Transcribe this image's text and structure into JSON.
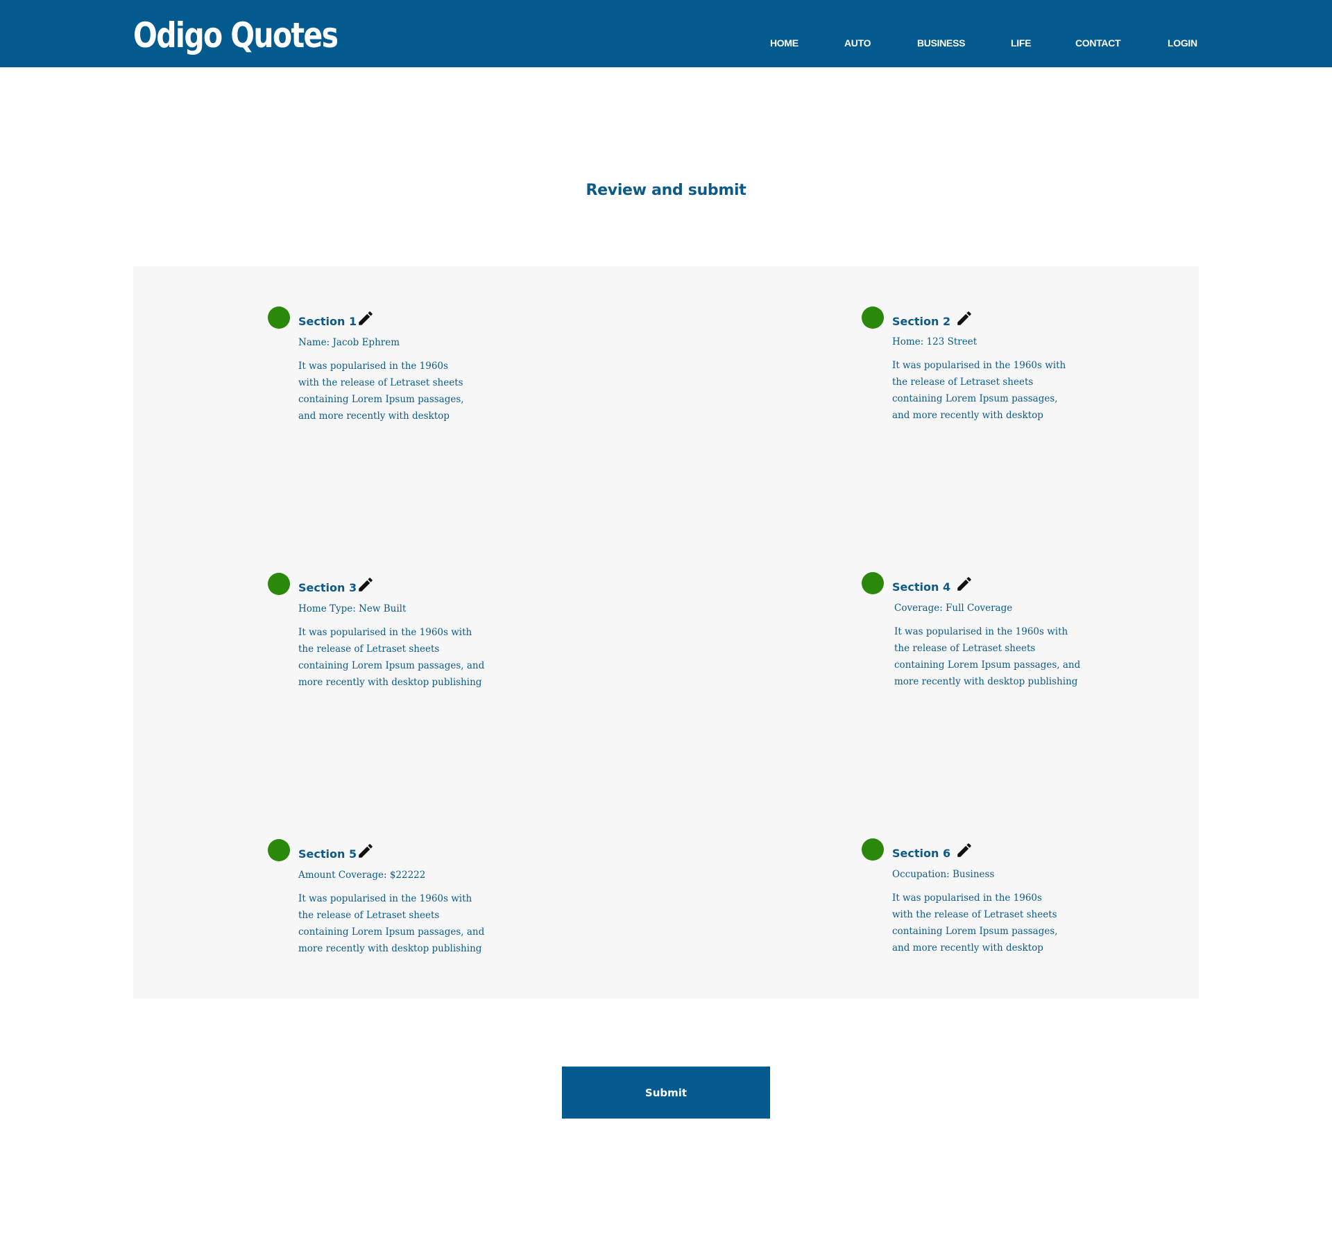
{
  "header": {
    "logo": "Odigo Quotes",
    "nav": [
      "HOME",
      "AUTO",
      "BUSINESS",
      "LIFE",
      "CONTACT",
      "LOGIN"
    ]
  },
  "page": {
    "title": "Review and submit"
  },
  "sections": [
    {
      "title": "Section 1",
      "field": "Name: Jacob Ephrem",
      "desc": [
        "It was popularised in the 1960s",
        "with the release of Letraset sheets",
        "containing Lorem Ipsum passages,",
        "and more recently with desktop"
      ]
    },
    {
      "title": "Section 2",
      "field": "Home: 123 Street",
      "desc": [
        "It was popularised in the 1960s with",
        "the release of Letraset sheets",
        "containing Lorem Ipsum passages,",
        "and more recently with desktop"
      ]
    },
    {
      "title": "Section 3",
      "field": "Home Type: New Built",
      "desc": [
        "It was popularised in the 1960s with",
        "the release of Letraset sheets",
        "containing Lorem Ipsum passages, and",
        "more recently with desktop publishing"
      ]
    },
    {
      "title": "Section 4",
      "field": "Coverage: Full Coverage",
      "desc": [
        "It was popularised in the 1960s with",
        "the release of Letraset sheets",
        "containing Lorem Ipsum passages, and",
        "more recently with desktop publishing"
      ]
    },
    {
      "title": "Section 5",
      "field": "Amount Coverage: $22222",
      "desc": [
        "It was popularised in the 1960s with",
        "the release of Letraset sheets",
        "containing Lorem Ipsum passages, and",
        "more recently with desktop publishing"
      ]
    },
    {
      "title": "Section 6",
      "field": "Occupation: Business",
      "desc": [
        "It was popularised in the 1960s",
        "with the release of Letraset sheets",
        "containing Lorem Ipsum passages,",
        "and more recently with desktop"
      ]
    }
  ],
  "actions": {
    "submit_label": "Submit"
  },
  "colors": {
    "brand": "#035a8e",
    "text": "#0c5a88",
    "status_dot": "#2a890a",
    "panel_bg": "#f7f7f7"
  },
  "icons": {
    "edit": "pencil-icon"
  }
}
